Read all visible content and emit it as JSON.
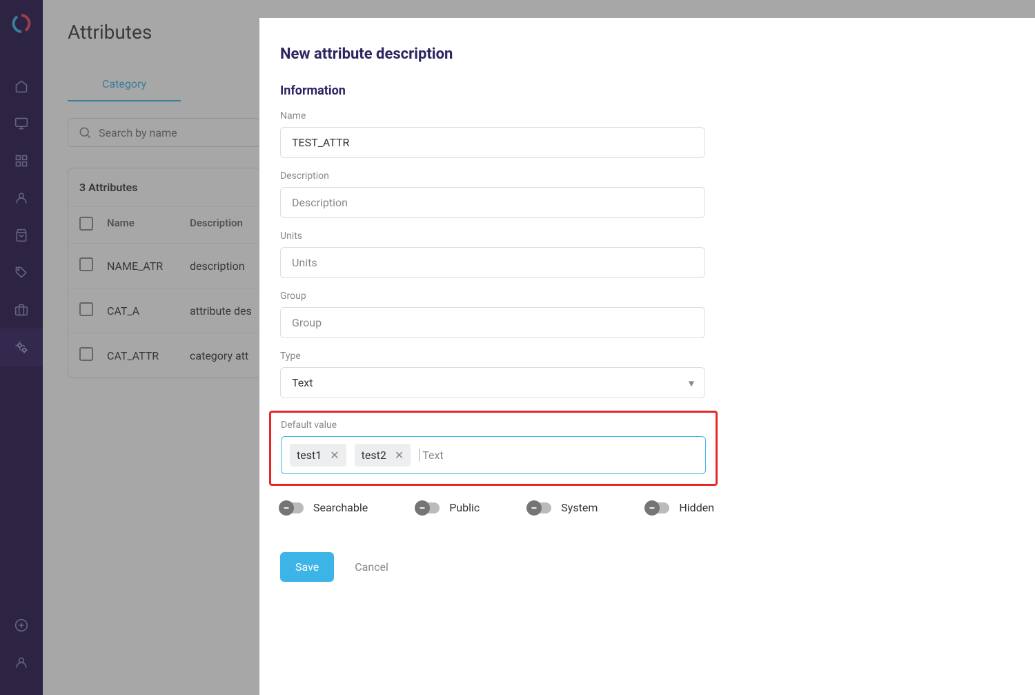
{
  "sidebar": {
    "items": [
      "home",
      "monitor",
      "grid",
      "user",
      "bag",
      "tag",
      "briefcase",
      "settings"
    ],
    "bottom": [
      "plus",
      "profile"
    ]
  },
  "page": {
    "title": "Attributes",
    "tab": "Category",
    "search_placeholder": "Search by name",
    "table_count": "3 Attributes",
    "col_name": "Name",
    "col_desc": "Description",
    "rows": [
      {
        "name": "NAME_ATR",
        "desc": "description"
      },
      {
        "name": "CAT_A",
        "desc": "attribute des"
      },
      {
        "name": "CAT_ATTR",
        "desc": "category att"
      }
    ]
  },
  "modal": {
    "title": "New attribute description",
    "section": "Information",
    "name_label": "Name",
    "name_value": "TEST_ATTR",
    "desc_label": "Description",
    "desc_placeholder": "Description",
    "units_label": "Units",
    "units_placeholder": "Units",
    "group_label": "Group",
    "group_placeholder": "Group",
    "type_label": "Type",
    "type_value": "Text",
    "default_label": "Default value",
    "default_tags": [
      "test1",
      "test2"
    ],
    "default_placeholder": "Text",
    "toggles": [
      {
        "label": "Searchable"
      },
      {
        "label": "Public"
      },
      {
        "label": "System"
      },
      {
        "label": "Hidden"
      }
    ],
    "save": "Save",
    "cancel": "Cancel"
  }
}
